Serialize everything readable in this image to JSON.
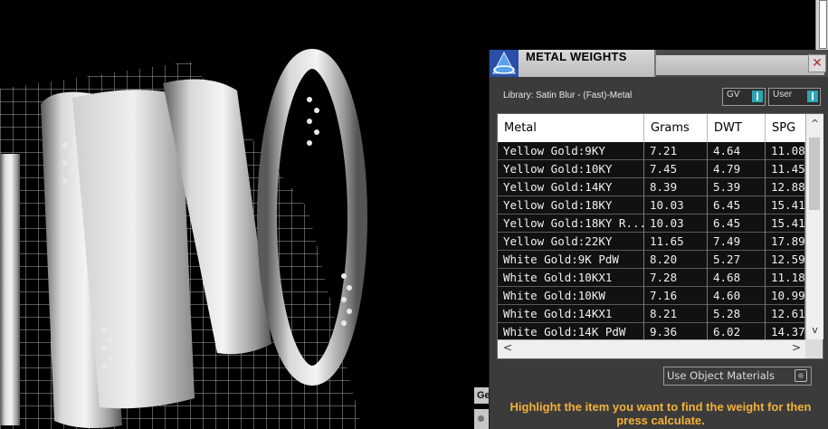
{
  "window": {
    "title": "METAL WEIGHTS",
    "close_glyph": "✕"
  },
  "library": {
    "label": "Library: Satin Blur - (Fast)-Metal",
    "toggles": [
      {
        "label": "GV",
        "state": "on"
      },
      {
        "label": "User",
        "state": "on"
      }
    ]
  },
  "table": {
    "columns": [
      "Metal",
      "Grams",
      "DWT",
      "SPG"
    ],
    "rows": [
      [
        "Yellow Gold:9KY",
        "7.21",
        "4.64",
        "11.08"
      ],
      [
        "Yellow Gold:10KY",
        "7.45",
        "4.79",
        "11.45"
      ],
      [
        "Yellow Gold:14KY",
        "8.39",
        "5.39",
        "12.88"
      ],
      [
        "Yellow Gold:18KY",
        "10.03",
        "6.45",
        "15.41"
      ],
      [
        "Yellow Gold:18KY R...",
        "10.03",
        "6.45",
        "15.41"
      ],
      [
        "Yellow Gold:22KY",
        "11.65",
        "7.49",
        "17.89"
      ],
      [
        "White Gold:9K PdW",
        "8.20",
        "5.27",
        "12.59"
      ],
      [
        "White Gold:10KX1",
        "7.28",
        "4.68",
        "11.18"
      ],
      [
        "White Gold:10KW",
        "7.16",
        "4.60",
        "10.99"
      ],
      [
        "White Gold:14KX1",
        "8.21",
        "5.28",
        "12.61"
      ],
      [
        "White Gold:14K PdW",
        "9.36",
        "6.02",
        "14.37"
      ]
    ]
  },
  "scroll": {
    "up": "^",
    "down": "v",
    "left": "<",
    "right": ">"
  },
  "options": {
    "use_object_materials": "Use Object Materials"
  },
  "hint": "Highlight the item you want to find the weight for then press calculate.",
  "background_tab": {
    "label": "Ge"
  },
  "colors": {
    "panel": "#3b3b3b",
    "hint": "#f3b23a",
    "toggle_on": "#2aa6b4",
    "viewport": "#000000"
  }
}
